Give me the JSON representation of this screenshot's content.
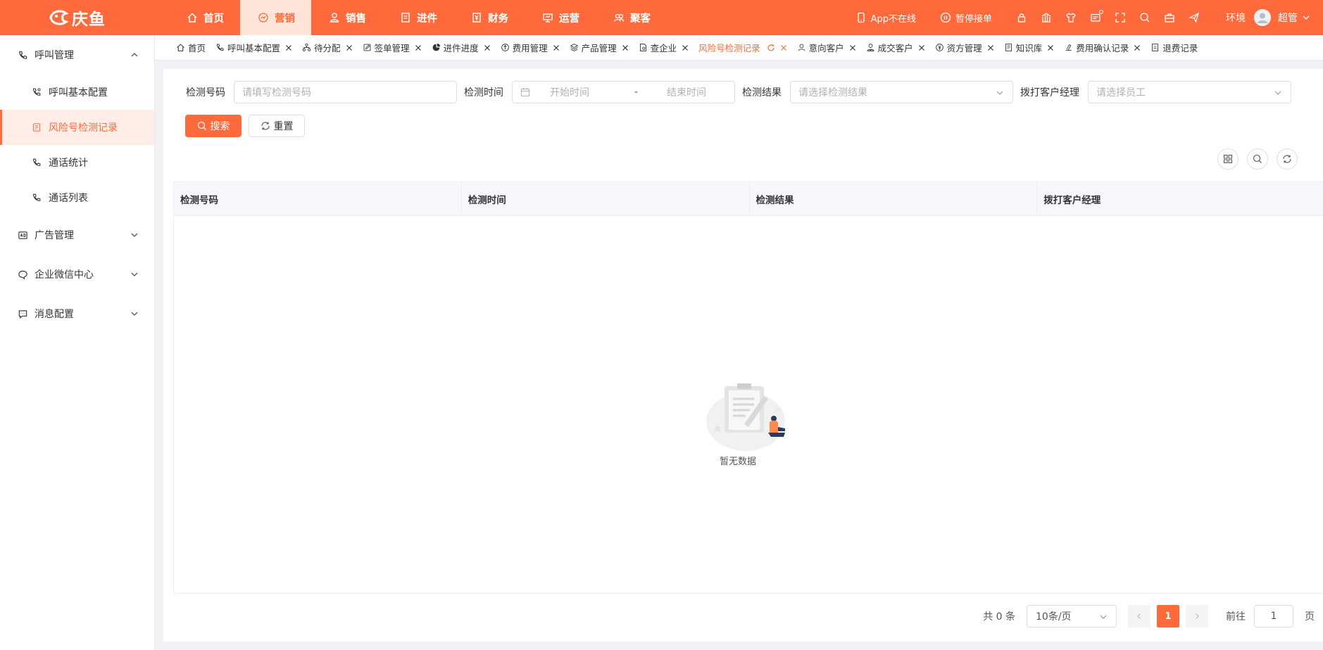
{
  "brand": {
    "name": "庆鱼",
    "color": "#ff6a3d"
  },
  "topnav": [
    {
      "label": "首页",
      "icon": "home-icon",
      "active": false
    },
    {
      "label": "营销",
      "icon": "marketing-icon",
      "active": true
    },
    {
      "label": "销售",
      "icon": "sales-icon",
      "active": false
    },
    {
      "label": "进件",
      "icon": "document-icon",
      "active": false
    },
    {
      "label": "财务",
      "icon": "finance-icon",
      "active": false
    },
    {
      "label": "运营",
      "icon": "operation-icon",
      "active": false
    },
    {
      "label": "聚客",
      "icon": "customers-icon",
      "active": false
    }
  ],
  "topright": {
    "app_status": "App不在线",
    "pause_label": "暂停接单",
    "env_label": "环境",
    "user_name": "超管"
  },
  "sidebar": {
    "groups": [
      {
        "label": "呼叫管理",
        "icon": "phone-icon",
        "expanded": true,
        "items": [
          {
            "label": "呼叫基本配置",
            "icon": "phone-config-icon",
            "active": false
          },
          {
            "label": "风险号检测记录",
            "icon": "record-icon",
            "active": true
          },
          {
            "label": "通话统计",
            "icon": "call-stats-icon",
            "active": false
          },
          {
            "label": "通话列表",
            "icon": "call-list-icon",
            "active": false
          }
        ]
      },
      {
        "label": "广告管理",
        "icon": "ad-icon",
        "expanded": false,
        "items": []
      },
      {
        "label": "企业微信中心",
        "icon": "wechat-icon",
        "expanded": false,
        "items": []
      },
      {
        "label": "消息配置",
        "icon": "message-icon",
        "expanded": false,
        "items": []
      }
    ]
  },
  "tabs": [
    {
      "label": "首页",
      "icon": "home-icon",
      "closable": false,
      "active": false
    },
    {
      "label": "呼叫基本配置",
      "icon": "phone-config-icon",
      "closable": true,
      "active": false
    },
    {
      "label": "待分配",
      "icon": "org-icon",
      "closable": true,
      "active": false
    },
    {
      "label": "签单管理",
      "icon": "edit-icon",
      "closable": true,
      "active": false
    },
    {
      "label": "进件进度",
      "icon": "pie-icon",
      "closable": true,
      "active": false
    },
    {
      "label": "费用管理",
      "icon": "money-icon",
      "closable": true,
      "active": false
    },
    {
      "label": "产品管理",
      "icon": "layers-icon",
      "closable": true,
      "active": false
    },
    {
      "label": "查企业",
      "icon": "company-icon",
      "closable": true,
      "active": false
    },
    {
      "label": "风险号检测记录",
      "icon": "",
      "closable": true,
      "active": true
    },
    {
      "label": "意向客户",
      "icon": "user-icon",
      "closable": true,
      "active": false
    },
    {
      "label": "成交客户",
      "icon": "user-deal-icon",
      "closable": true,
      "active": false
    },
    {
      "label": "资方管理",
      "icon": "funder-icon",
      "closable": true,
      "active": false
    },
    {
      "label": "知识库",
      "icon": "book-icon",
      "closable": true,
      "active": false
    },
    {
      "label": "费用确认记录",
      "icon": "confirm-icon",
      "closable": true,
      "active": false
    },
    {
      "label": "退费记录",
      "icon": "refund-icon",
      "closable": false,
      "active": false
    }
  ],
  "filters": {
    "number_label": "检测号码",
    "number_placeholder": "请填写检测号码",
    "time_label": "检测时间",
    "start_placeholder": "开始时间",
    "range_sep": "-",
    "end_placeholder": "结束时间",
    "result_label": "检测结果",
    "result_placeholder": "请选择检测结果",
    "manager_label": "拨打客户经理",
    "manager_placeholder": "请选择员工"
  },
  "buttons": {
    "search": "搜索",
    "reset": "重置"
  },
  "table": {
    "columns": [
      "检测号码",
      "检测时间",
      "检测结果",
      "拨打客户经理"
    ],
    "rows": [],
    "empty_text": "暂无数据"
  },
  "pagination": {
    "total_text": "共 0 条",
    "page_size": "10条/页",
    "current_page": "1",
    "goto_label": "前往",
    "goto_value": "1",
    "page_unit": "页"
  }
}
